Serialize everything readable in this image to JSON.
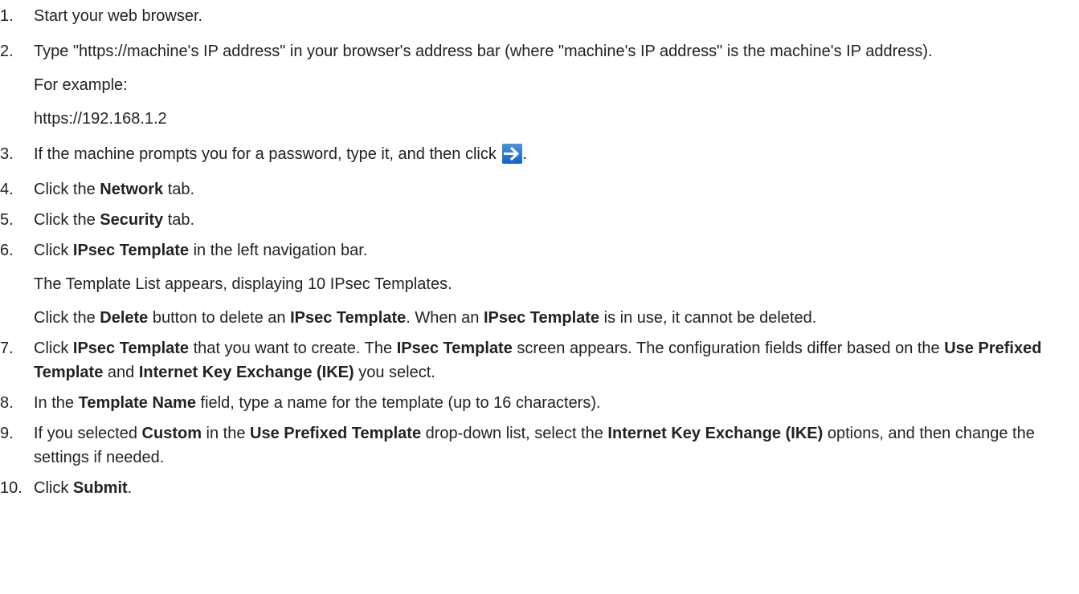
{
  "steps": [
    {
      "num": "1.",
      "text": "Start your web browser."
    },
    {
      "num": "2.",
      "text": "Type \"https://machine's IP address\" in your browser's address bar (where \"machine's IP address\" is the machine's IP address).",
      "example_label": "For example:",
      "example_value": "https://192.168.1.2"
    },
    {
      "num": "3.",
      "text": "If the machine prompts you for a password, type it, and then click ",
      "after": "."
    },
    {
      "num": "4.",
      "pre": "Click the ",
      "bold": "Network",
      "post": " tab."
    },
    {
      "num": "5.",
      "pre": "Click the ",
      "bold": "Security",
      "post": " tab."
    },
    {
      "num": "6.",
      "pre": "Click ",
      "bold": "IPsec Template",
      "post": " in the left navigation bar.",
      "note1": "The Template List appears, displaying 10 IPsec Templates.",
      "note2_a": "Click the ",
      "note2_b": "Delete",
      "note2_c": " button to delete an ",
      "note2_d": "IPsec Template",
      "note2_e": ". When an ",
      "note2_f": "IPsec Template",
      "note2_g": " is in use, it cannot be deleted."
    },
    {
      "num": "7.",
      "a": "Click ",
      "b": "IPsec Template",
      "c": " that you want to create. The ",
      "d": "IPsec Template",
      "e": " screen appears. The configuration fields differ based on the ",
      "f": "Use Prefixed Template",
      "g": " and ",
      "h": "Internet Key Exchange (IKE)",
      "i": " you select."
    },
    {
      "num": "8.",
      "a": "In the ",
      "b": "Template Name",
      "c": " field, type a name for the template (up to 16 characters)."
    },
    {
      "num": "9.",
      "a": "If you selected ",
      "b": "Custom",
      "c": " in the ",
      "d": "Use Prefixed Template",
      "e": " drop-down list, select the ",
      "f": "Internet Key Exchange (IKE)",
      "g": " options, and then change the settings if needed."
    },
    {
      "num": "10.",
      "a": "Click ",
      "b": "Submit",
      "c": "."
    }
  ],
  "icons": {
    "submit_arrow": "arrow-right-icon"
  },
  "colors": {
    "arrow_button": "#1f6fd0",
    "text": "#222222"
  }
}
